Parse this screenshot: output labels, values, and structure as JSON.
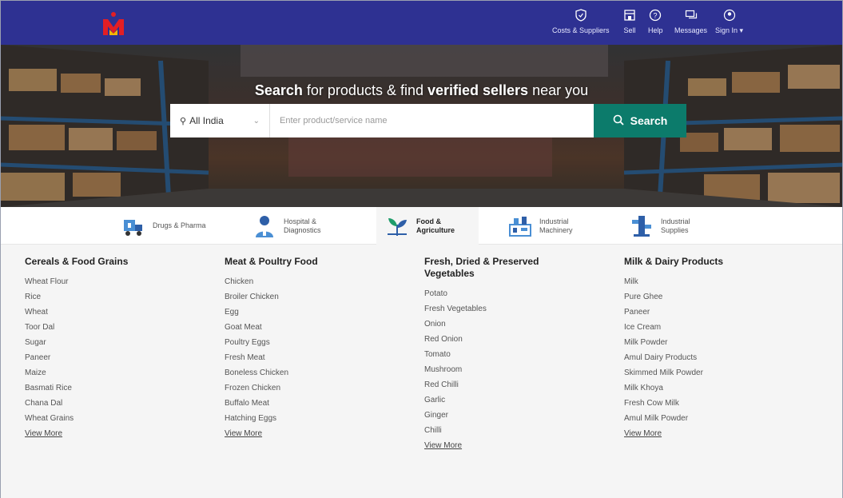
{
  "header": {
    "nav": [
      {
        "label": "Costs & Suppliers",
        "icon": "shield-icon"
      },
      {
        "label": "Sell",
        "icon": "storefront-icon"
      },
      {
        "label": "Help",
        "icon": "help-icon"
      },
      {
        "label": "Messages",
        "icon": "messages-icon"
      },
      {
        "label": "Sign In",
        "icon": "user-icon"
      }
    ]
  },
  "hero": {
    "title_part1": "Search",
    "title_part2": " for products & find ",
    "title_part3": "verified sellers",
    "title_part4": " near you",
    "location": "All India",
    "search_placeholder": "Enter product/service name",
    "search_button": "Search"
  },
  "categories": [
    {
      "label": "Drugs & Pharma",
      "icon": "pharma-truck-icon"
    },
    {
      "label": "Hospital & Diagnostics",
      "icon": "doctor-icon"
    },
    {
      "label": "Food & Agriculture",
      "icon": "sprout-icon"
    },
    {
      "label": "Industrial Machinery",
      "icon": "machinery-icon"
    },
    {
      "label": "Industrial Supplies",
      "icon": "supplies-icon"
    }
  ],
  "columns": [
    {
      "title": "Cereals & Food Grains",
      "items": [
        "Wheat Flour",
        "Rice",
        "Wheat",
        "Toor Dal",
        "Sugar",
        "Paneer",
        "Maize",
        "Basmati Rice",
        "Chana Dal",
        "Wheat Grains"
      ],
      "more": "View More"
    },
    {
      "title": "Meat & Poultry Food",
      "items": [
        "Chicken",
        "Broiler Chicken",
        "Egg",
        "Goat Meat",
        "Poultry Eggs",
        "Fresh Meat",
        "Boneless Chicken",
        "Frozen Chicken",
        "Buffalo Meat",
        "Hatching Eggs"
      ],
      "more": "View More"
    },
    {
      "title": "Fresh, Dried & Preserved Vegetables",
      "items": [
        "Potato",
        "Fresh Vegetables",
        "Onion",
        "Red Onion",
        "Tomato",
        "Mushroom",
        "Red Chilli",
        "Garlic",
        "Ginger",
        "Chilli"
      ],
      "more": "View More"
    },
    {
      "title": "Milk & Dairy Products",
      "items": [
        "Milk",
        "Pure Ghee",
        "Paneer",
        "Ice Cream",
        "Milk Powder",
        "Amul Dairy Products",
        "Skimmed Milk Powder",
        "Milk Khoya",
        "Fresh Cow Milk",
        "Amul Milk Powder"
      ],
      "more": "View More"
    }
  ],
  "colors": {
    "header": "#2e3192",
    "search_button": "#0c7b6b",
    "logo": "#e31e24"
  }
}
